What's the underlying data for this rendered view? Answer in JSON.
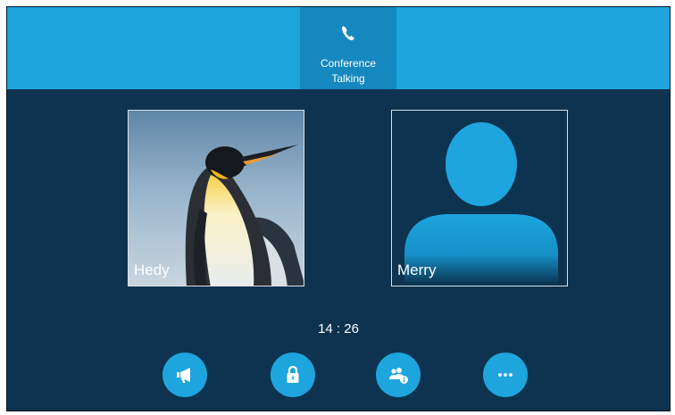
{
  "status": {
    "call_type": "Conference",
    "call_state": "Talking",
    "icon": "phone-icon"
  },
  "participants": [
    {
      "name": "Hedy",
      "avatar": "penguin-photo"
    },
    {
      "name": "Merry",
      "avatar": "default-contact-silhouette"
    }
  ],
  "call_duration": "14 : 26",
  "actions": [
    {
      "icon": "megaphone-icon"
    },
    {
      "icon": "lock-icon"
    },
    {
      "icon": "manage-participants-icon"
    },
    {
      "icon": "more-icon"
    }
  ],
  "colors": {
    "background": "#0d3350",
    "accent": "#1ea5de",
    "accent_dark": "#1588bf",
    "text": "#ffffff"
  }
}
